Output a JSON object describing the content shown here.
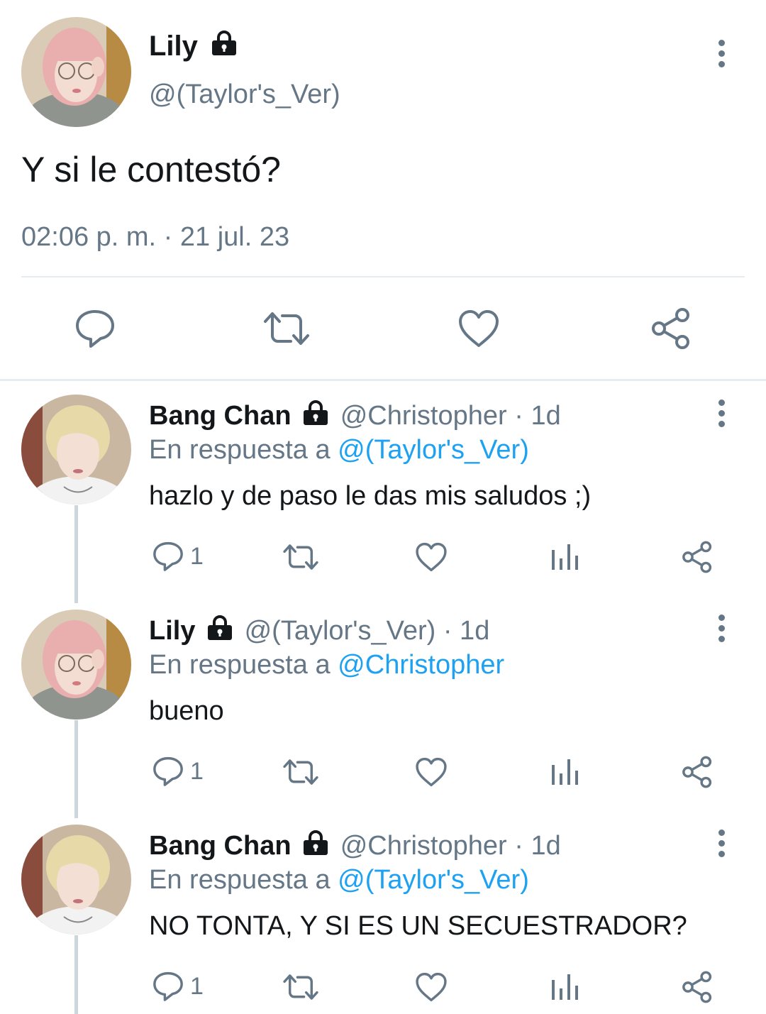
{
  "main_tweet": {
    "name": "Lily",
    "handle": "@(Taylor's_Ver)",
    "text": "Y si le contestó?",
    "timestamp": "02:06 p. m. · 21 jul. 23"
  },
  "replies": [
    {
      "name": "Bang Chan",
      "handle": "@Christopher",
      "time": "· 1d",
      "reply_prefix": "En respuesta a",
      "reply_to": "@(Taylor's_Ver)",
      "text": "hazlo y de paso le das mis saludos ;)",
      "reply_count": "1"
    },
    {
      "name": "Lily",
      "handle": "@(Taylor's_Ver)",
      "time": "· 1d",
      "reply_prefix": "En respuesta a",
      "reply_to": "@Christopher",
      "text": "bueno",
      "reply_count": "1"
    },
    {
      "name": "Bang Chan",
      "handle": "@Christopher",
      "time": "· 1d",
      "reply_prefix": "En respuesta a",
      "reply_to": "@(Taylor's_Ver)",
      "text": "NO TONTA, Y SI ES UN SECUESTRADOR?",
      "reply_count": "1"
    }
  ],
  "colors": {
    "text": "#14171a",
    "secondary": "#657786",
    "link": "#1da1f2",
    "border": "#e6ecf0"
  },
  "icons": [
    "lock-icon",
    "more-options-icon",
    "reply-icon",
    "retweet-icon",
    "like-icon",
    "share-icon",
    "analytics-icon"
  ]
}
